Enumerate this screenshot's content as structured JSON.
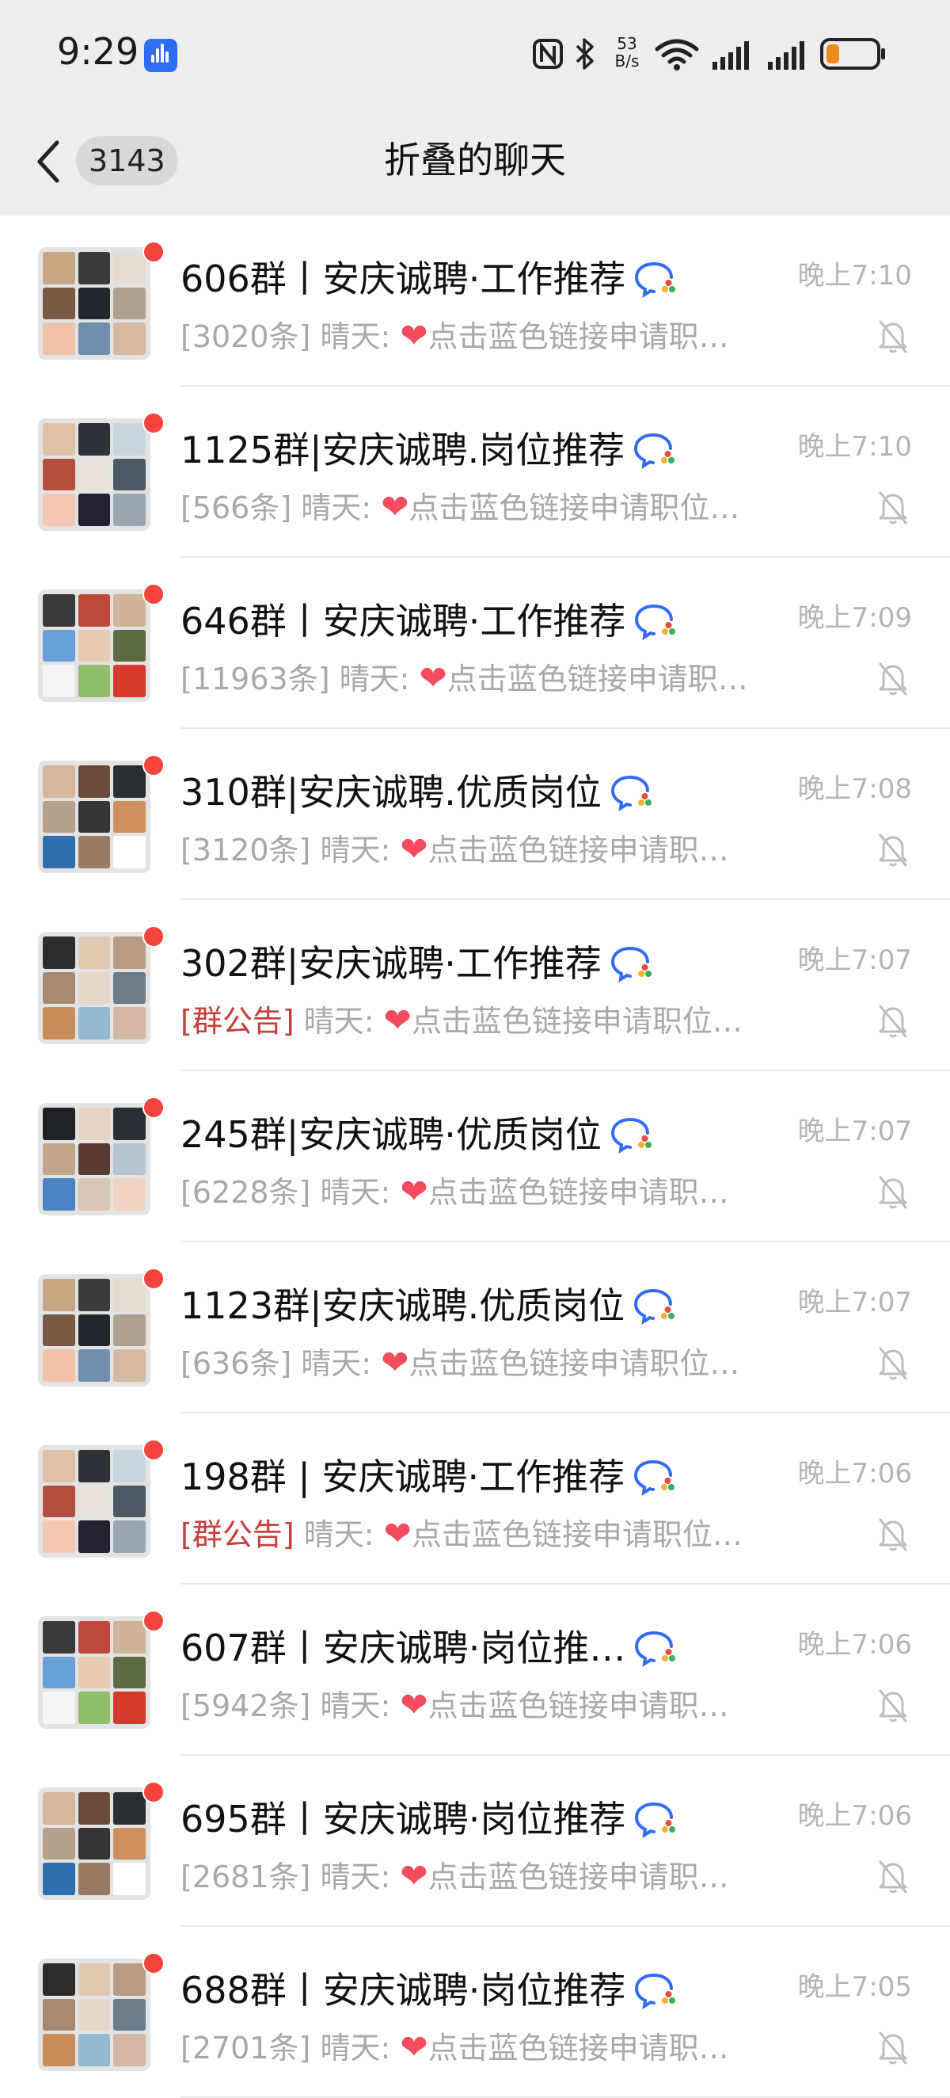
{
  "status_bar": {
    "time": "9:29",
    "net_speed_value": "53",
    "net_speed_unit": "B/s",
    "icons": [
      "voice-assistant-icon",
      "nfc-icon",
      "bluetooth-icon",
      "wifi-icon",
      "signal-icon",
      "signal-icon",
      "battery-low-icon"
    ]
  },
  "header": {
    "back_count": "3143",
    "title": "折叠的聊天"
  },
  "colors": {
    "accent_blue": "#2f6cf6",
    "unread_dot": "#f4433c",
    "announcement_red": "#c63d3a",
    "heart": "#f44b5e",
    "battery_low": "#f08a1c"
  },
  "chats": [
    {
      "name": "606群丨安庆诚聘·工作推荐",
      "time": "晚上7:10",
      "tag": "[3020条]",
      "tag_style": "count",
      "sender": "晴天:",
      "heart": "❤",
      "message": "点击蓝色链接申请职…",
      "muted": true,
      "unread": true
    },
    {
      "name": "1125群|安庆诚聘.岗位推荐",
      "time": "晚上7:10",
      "tag": "[566条]",
      "tag_style": "count",
      "sender": "晴天:",
      "heart": "❤",
      "message": "点击蓝色链接申请职位…",
      "muted": true,
      "unread": true
    },
    {
      "name": "646群丨安庆诚聘·工作推荐",
      "time": "晚上7:09",
      "tag": "[11963条]",
      "tag_style": "count",
      "sender": "晴天:",
      "heart": "❤",
      "message": "点击蓝色链接申请职…",
      "muted": true,
      "unread": true
    },
    {
      "name": "310群|安庆诚聘.优质岗位",
      "time": "晚上7:08",
      "tag": "[3120条]",
      "tag_style": "count",
      "sender": "晴天:",
      "heart": "❤",
      "message": "点击蓝色链接申请职…",
      "muted": true,
      "unread": true
    },
    {
      "name": "302群|安庆诚聘·工作推荐",
      "time": "晚上7:07",
      "tag": "[群公告]",
      "tag_style": "announcement",
      "sender": "晴天:",
      "heart": "❤",
      "message": "点击蓝色链接申请职位…",
      "muted": true,
      "unread": true
    },
    {
      "name": "245群|安庆诚聘·优质岗位",
      "time": "晚上7:07",
      "tag": "[6228条]",
      "tag_style": "count",
      "sender": "晴天:",
      "heart": "❤",
      "message": "点击蓝色链接申请职…",
      "muted": true,
      "unread": true
    },
    {
      "name": "1123群|安庆诚聘.优质岗位",
      "time": "晚上7:07",
      "tag": "[636条]",
      "tag_style": "count",
      "sender": "晴天:",
      "heart": "❤",
      "message": "点击蓝色链接申请职位…",
      "muted": true,
      "unread": true
    },
    {
      "name": "198群 | 安庆诚聘·工作推荐",
      "time": "晚上7:06",
      "tag": "[群公告]",
      "tag_style": "announcement",
      "sender": "晴天:",
      "heart": "❤",
      "message": "点击蓝色链接申请职位…",
      "muted": true,
      "unread": true
    },
    {
      "name": "607群丨安庆诚聘·岗位推…",
      "time": "晚上7:06",
      "tag": "[5942条]",
      "tag_style": "count",
      "sender": "晴天:",
      "heart": "❤",
      "message": "点击蓝色链接申请职…",
      "muted": true,
      "unread": true
    },
    {
      "name": "695群丨安庆诚聘·岗位推荐",
      "time": "晚上7:06",
      "tag": "[2681条]",
      "tag_style": "count",
      "sender": "晴天:",
      "heart": "❤",
      "message": "点击蓝色链接申请职…",
      "muted": true,
      "unread": true
    },
    {
      "name": "688群丨安庆诚聘·岗位推荐",
      "time": "晚上7:05",
      "tag": "[2701条]",
      "tag_style": "count",
      "sender": "晴天:",
      "heart": "❤",
      "message": "点击蓝色链接申请职…",
      "muted": true,
      "unread": true
    }
  ]
}
